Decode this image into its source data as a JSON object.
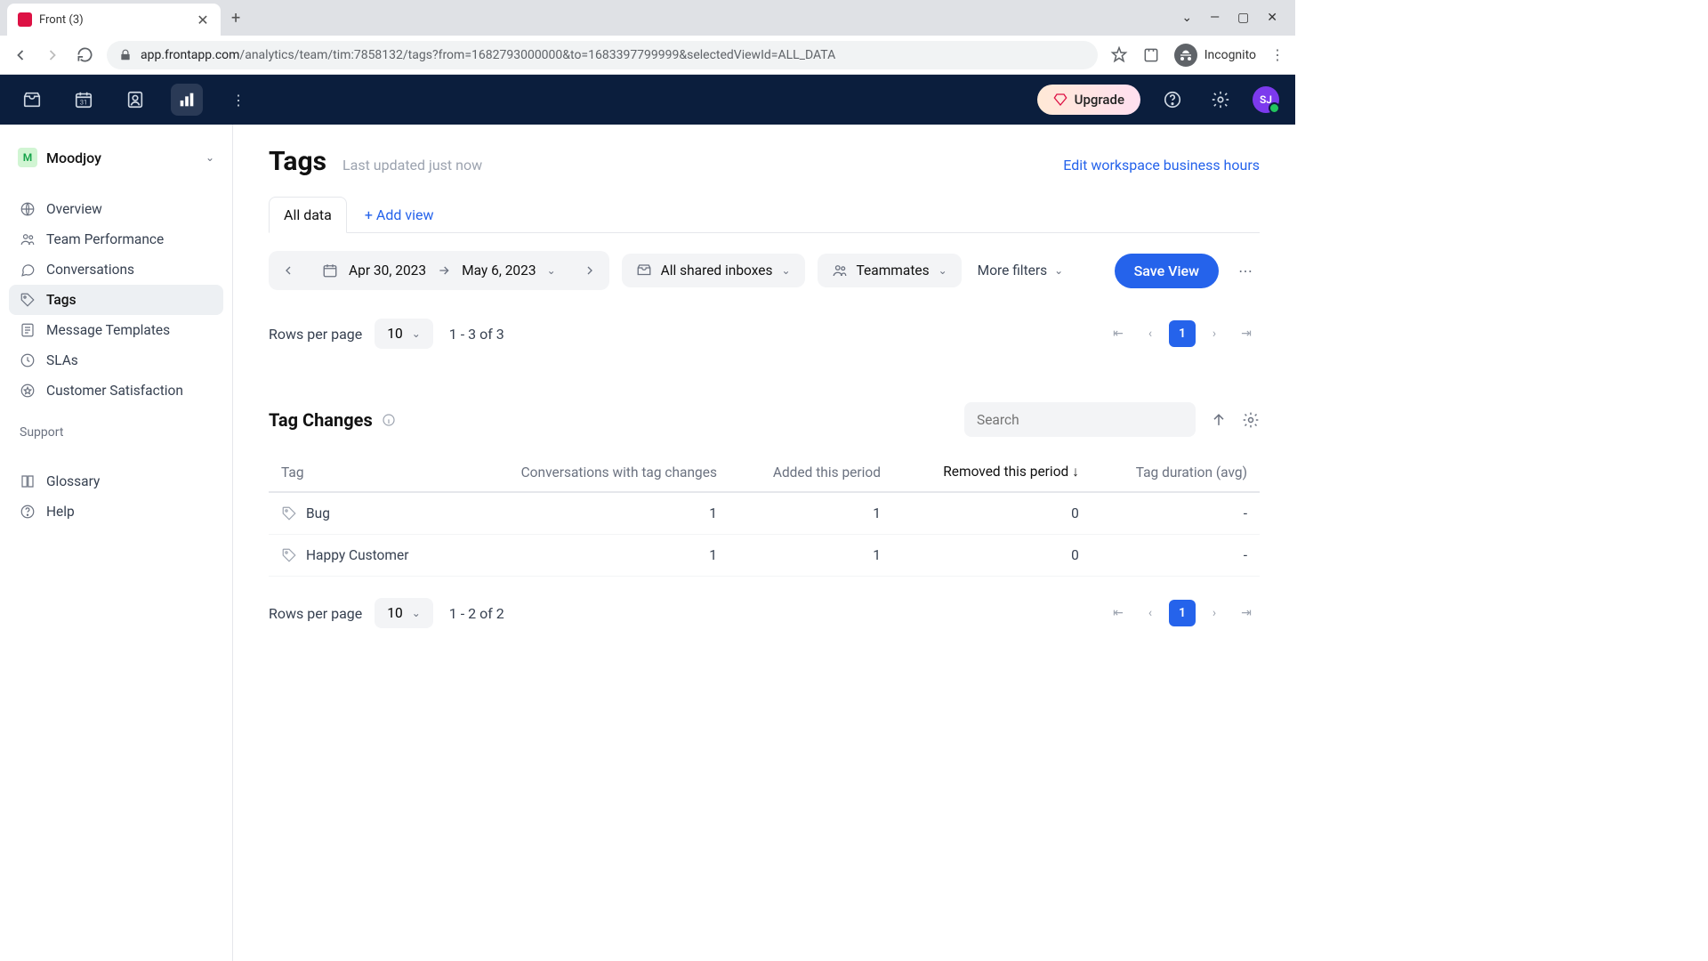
{
  "browser": {
    "tab_title": "Front (3)",
    "url_domain": "app.frontapp.com",
    "url_path": "/analytics/team/tim:7858132/tags?from=1682793000000&to=1683397799999&selectedViewId=ALL_DATA",
    "incognito_label": "Incognito"
  },
  "topbar": {
    "upgrade_label": "Upgrade",
    "avatar_initials": "SJ"
  },
  "sidebar": {
    "workspace_badge": "M",
    "workspace_name": "Moodjoy",
    "items": [
      {
        "label": "Overview",
        "icon": "globe"
      },
      {
        "label": "Team Performance",
        "icon": "people"
      },
      {
        "label": "Conversations",
        "icon": "chat"
      },
      {
        "label": "Tags",
        "icon": "tag",
        "active": true
      },
      {
        "label": "Message Templates",
        "icon": "template"
      },
      {
        "label": "SLAs",
        "icon": "clock"
      },
      {
        "label": "Customer Satisfaction",
        "icon": "star"
      }
    ],
    "support_label": "Support",
    "support_items": [
      {
        "label": "Glossary",
        "icon": "book"
      },
      {
        "label": "Help",
        "icon": "help"
      }
    ]
  },
  "page": {
    "title": "Tags",
    "subtitle": "Last updated just now",
    "biz_hours_link": "Edit workspace business hours",
    "active_tab": "All data",
    "add_view_label": "+ Add view",
    "date_from": "Apr 30, 2023",
    "date_to": "May 6, 2023",
    "filter_inboxes": "All shared inboxes",
    "filter_teammates": "Teammates",
    "more_filters": "More filters",
    "save_view": "Save View"
  },
  "pager_top": {
    "rpp_label": "Rows per page",
    "rpp_value": "10",
    "range": "1 - 3 of 3",
    "current_page": "1"
  },
  "tag_changes": {
    "title": "Tag Changes",
    "search_placeholder": "Search",
    "columns": {
      "tag": "Tag",
      "conv": "Conversations with tag changes",
      "added": "Added this period",
      "removed": "Removed this period",
      "duration": "Tag duration (avg)"
    },
    "rows": [
      {
        "tag": "Bug",
        "conv": "1",
        "added": "1",
        "removed": "0",
        "duration": "-"
      },
      {
        "tag": "Happy Customer",
        "conv": "1",
        "added": "1",
        "removed": "0",
        "duration": "-"
      }
    ]
  },
  "pager_bottom": {
    "rpp_label": "Rows per page",
    "rpp_value": "10",
    "range": "1 - 2 of 2",
    "current_page": "1"
  }
}
